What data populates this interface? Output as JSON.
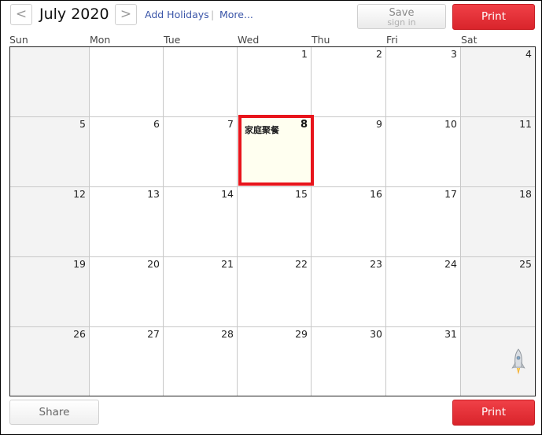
{
  "header": {
    "prev_label": "<",
    "next_label": ">",
    "month_title": "July 2020",
    "add_holidays": "Add Holidays",
    "separator": "|",
    "more": "More...",
    "save_label": "Save",
    "save_sub": "sign in",
    "print_label": "Print"
  },
  "weekdays": [
    "Sun",
    "Mon",
    "Tue",
    "Wed",
    "Thu",
    "Fri",
    "Sat"
  ],
  "weeks": [
    [
      "",
      "",
      "",
      "1",
      "2",
      "3",
      "4"
    ],
    [
      "5",
      "6",
      "7",
      "8",
      "9",
      "10",
      "11"
    ],
    [
      "12",
      "13",
      "14",
      "15",
      "16",
      "17",
      "18"
    ],
    [
      "19",
      "20",
      "21",
      "22",
      "23",
      "24",
      "25"
    ],
    [
      "26",
      "27",
      "28",
      "29",
      "30",
      "31",
      ""
    ]
  ],
  "selected_day": {
    "day": "8",
    "event": "家庭聚餐"
  },
  "footer": {
    "share_label": "Share",
    "print_label": "Print"
  },
  "colors": {
    "accent_red": "#e8141b",
    "weekend_bg": "#f3f3f3",
    "link_blue": "#3a55a8"
  },
  "icons": {
    "rocket": "rocket-icon"
  }
}
